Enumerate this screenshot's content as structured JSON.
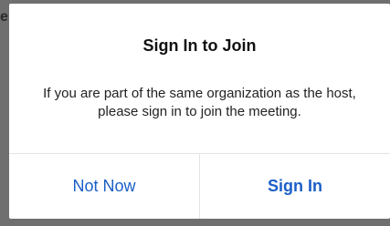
{
  "background": {
    "behind_text": "e"
  },
  "dialog": {
    "title": "Sign In to Join",
    "message": "If you are part of the same organization as the host, please sign in to join the meeting.",
    "buttons": {
      "secondary_label": "Not Now",
      "primary_label": "Sign In"
    }
  },
  "colors": {
    "overlay": "#6f6f6f",
    "dialog_bg": "#ffffff",
    "button_text": "#1a5fc7",
    "divider": "#e3e3e3"
  }
}
